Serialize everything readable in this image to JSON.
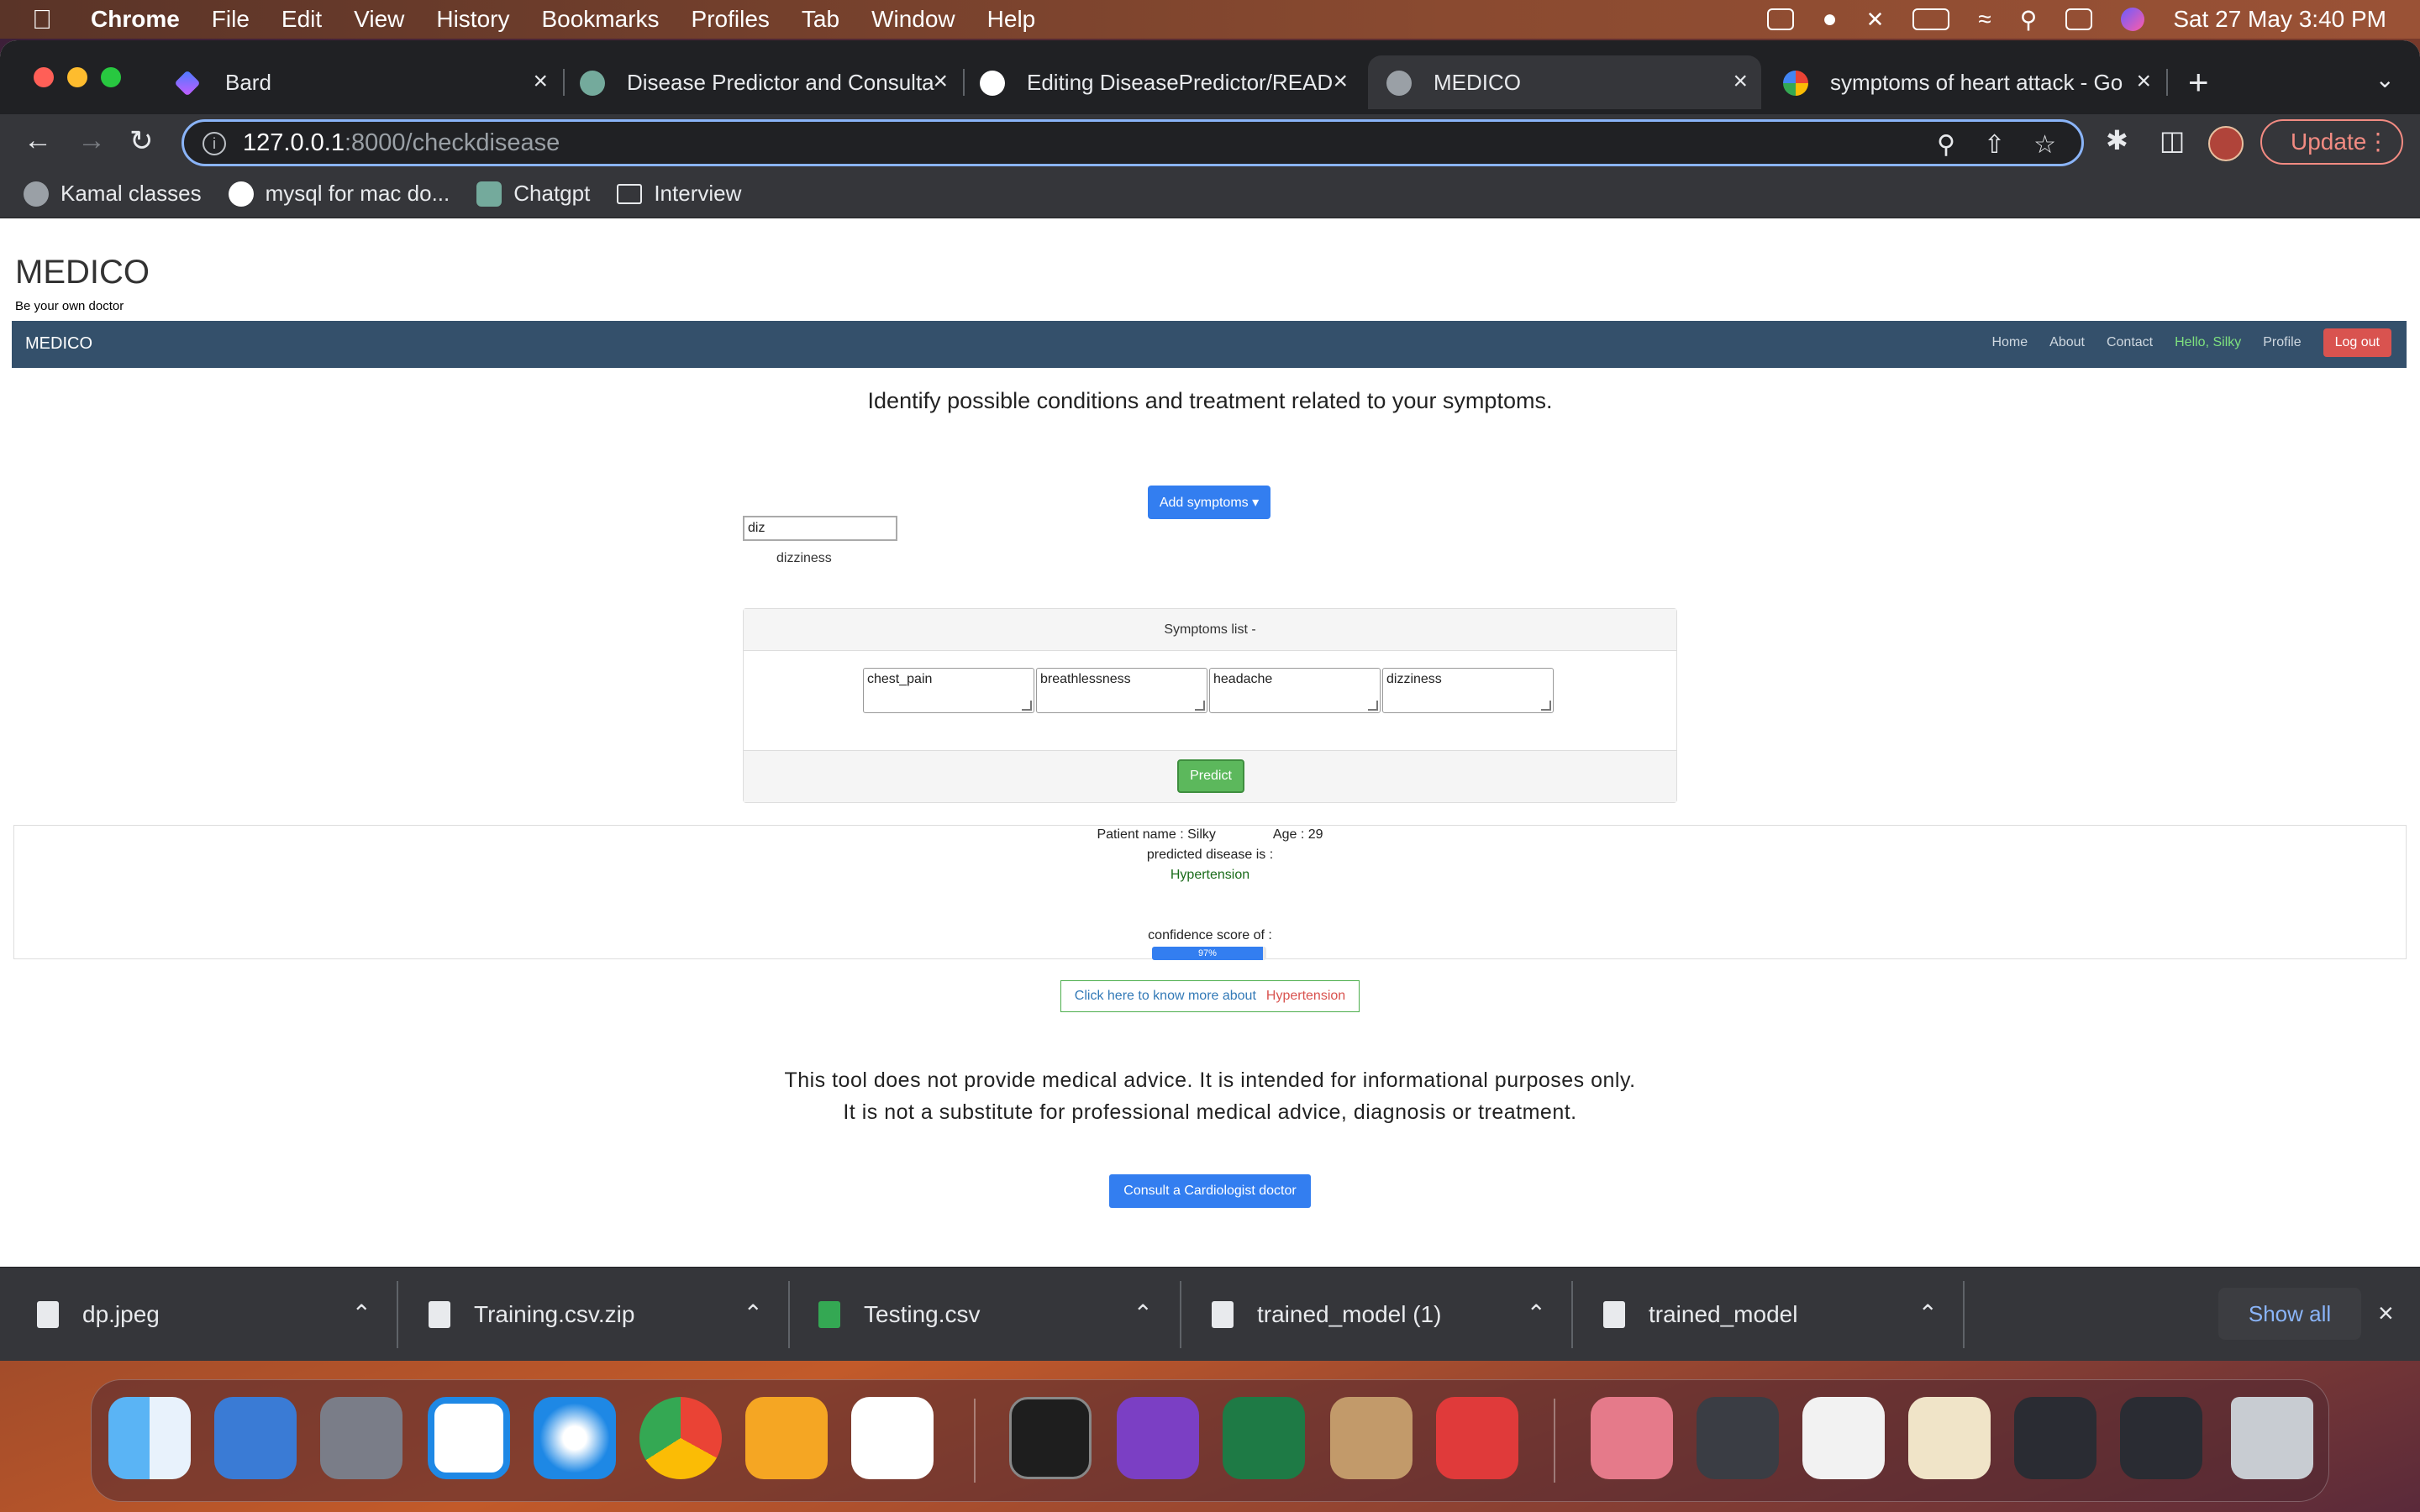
{
  "menubar": {
    "app": "Chrome",
    "items": [
      "File",
      "Edit",
      "View",
      "History",
      "Bookmarks",
      "Profiles",
      "Tab",
      "Window",
      "Help"
    ],
    "clock": "Sat 27 May  3:40 PM"
  },
  "tabs": [
    {
      "title": "Bard"
    },
    {
      "title": "Disease Predictor and Consulta"
    },
    {
      "title": "Editing DiseasePredictor/READ"
    },
    {
      "title": "MEDICO"
    },
    {
      "title": "symptoms of heart attack - Go"
    }
  ],
  "address": {
    "host": "127.0.0.1",
    "path": ":8000/checkdisease"
  },
  "update_label": "Update",
  "bookmarks": [
    "Kamal classes",
    "mysql for mac do...",
    "Chatgpt",
    "Interview"
  ],
  "site": {
    "brand": "MEDICO",
    "tagline": "Be your own doctor",
    "nav_brand": "MEDICO",
    "nav": {
      "home": "Home",
      "about": "About",
      "contact": "Contact",
      "hello": "Hello, Silky",
      "profile": "Profile",
      "logout": "Log out"
    },
    "heading": "Identify possible conditions and treatment related to your symptoms.",
    "add_symptoms": "Add symptoms ▾",
    "search_value": "diz",
    "suggestion": "dizziness",
    "symptoms_header": "Symptoms list -",
    "symptoms": [
      "chest_pain",
      "breathlessness",
      "headache",
      "dizziness"
    ],
    "predict": "Predict",
    "patient_name": "Patient name : Silky",
    "age": "Age : 29",
    "predicted_label": "predicted disease is :",
    "disease": "Hypertension",
    "confidence_label": "confidence score of :",
    "confidence": 97,
    "confidence_text": "97%",
    "know_more": "Click here to know more about",
    "know_more_disease": "Hypertension",
    "disclaimer1": "This tool does not provide medical advice. It is intended for informational purposes only.",
    "disclaimer2": "It is not a substitute for professional medical advice, diagnosis or treatment.",
    "consult": "Consult a Cardiologist doctor"
  },
  "downloads": {
    "files": [
      "dp.jpeg",
      "Training.csv.zip",
      "Testing.csv",
      "trained_model (1)",
      "trained_model"
    ],
    "show_all": "Show all"
  },
  "colors": {
    "navbar": "#34506b",
    "accent": "#337ef0",
    "predict": "#5cb85c",
    "logout": "#d9534f"
  }
}
